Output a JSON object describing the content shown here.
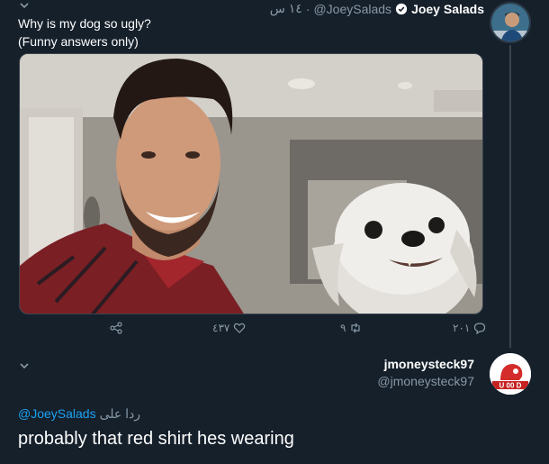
{
  "tweet1": {
    "display_name": "Joey Salads",
    "handle": "@JoeySalads",
    "time": "١٤ س",
    "separator": "·",
    "text_line1": "Why is my dog so ugly?",
    "text_line2": "(Funny answers only)",
    "actions": {
      "reply_count": "٢٠١",
      "retweet_count": "٩",
      "like_count": "٤٣٧"
    }
  },
  "tweet2": {
    "display_name": "jmoneysteck97",
    "handle": "@jmoneysteck97",
    "avatar_text": "U 00 D",
    "reply_prefix": "ردا على",
    "reply_to": "@JoeySalads",
    "text": "probably that red shirt hes wearing"
  },
  "colors": {
    "background": "#15202b",
    "text_muted": "#8899a6",
    "link": "#1da1f2",
    "divider": "#38444d"
  }
}
